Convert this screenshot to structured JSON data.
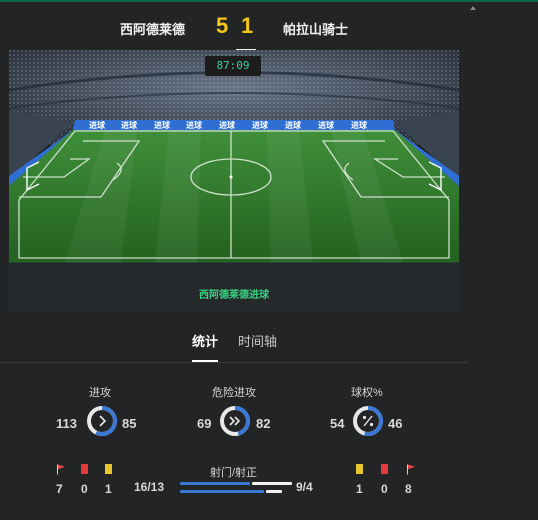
{
  "match": {
    "home_team": "西阿德莱德",
    "away_team": "帕拉山骑士",
    "home_score": "5",
    "away_score": "1",
    "clock": "87:09"
  },
  "field": {
    "event_text": "西阿德莱德进球",
    "board_text": "进球"
  },
  "tabs": {
    "stats": "统计",
    "timeline": "时间轴"
  },
  "stats": {
    "attack": {
      "label": "进攻",
      "home": "113",
      "away": "85",
      "home_share": 0.571
    },
    "dangerous_attack": {
      "label": "危险进攻",
      "home": "69",
      "away": "82",
      "home_share": 0.457
    },
    "possession": {
      "label": "球权%",
      "home": "54",
      "away": "46",
      "home_share": 0.54
    }
  },
  "events": {
    "home": {
      "corners": "7",
      "red_cards": "0",
      "yellow_cards": "1"
    },
    "away": {
      "yellow_cards": "1",
      "red_cards": "0",
      "corners": "8"
    }
  },
  "shots": {
    "label": "射门/射正",
    "home": "16/13",
    "away": "9/4",
    "home_shots_share": 0.64,
    "home_on_target_share": 0.765
  },
  "colors": {
    "accent_blue": "#3a78d6",
    "score_yellow": "#f5c518",
    "clock_green": "#37d19b",
    "event_green": "#37d37f",
    "corner_flag": "#e84545",
    "red_card": "#e23b3b",
    "yellow_card": "#e8c630"
  },
  "icons": {
    "attack": "chevron-right-icon",
    "dangerous_attack": "double-chevron-icon",
    "possession": "percent-icon",
    "corner": "corner-flag-icon"
  }
}
